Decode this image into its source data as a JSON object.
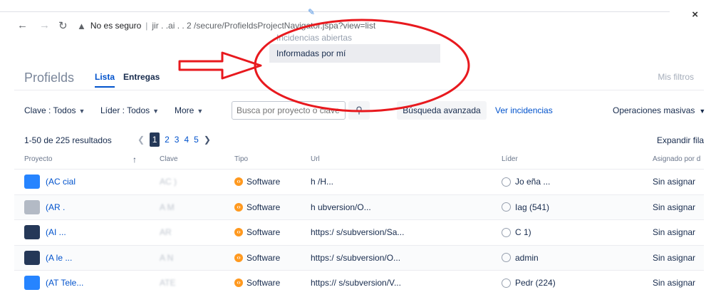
{
  "browser": {
    "security_label": "No es seguro",
    "url": "jir  .   .ai  .  .  2  /secure/ProfieldsProjectNavigator.jspa?view=list",
    "close_icon": "close-icon"
  },
  "dropdown": {
    "items": [
      {
        "label": "Incidencias abiertas"
      },
      {
        "label": "Informadas por mí"
      }
    ]
  },
  "header": {
    "title": "Profields",
    "tabs": [
      {
        "label": "Lista"
      },
      {
        "label": "Entregas"
      }
    ],
    "right_link": "Mis filtros"
  },
  "filters": {
    "clave": "Clave : Todos",
    "lider": "Líder : Todos",
    "more": "More",
    "search_placeholder": "Busca por proyecto o clave",
    "advanced": "Búsqueda avanzada",
    "ver": "Ver incidencias",
    "ops": "Operaciones masivas"
  },
  "pagination": {
    "results": "1-50 de 225 resultados",
    "pages": [
      "1",
      "2",
      "3",
      "4",
      "5"
    ],
    "current": "1",
    "expand": "Expandir fila"
  },
  "table": {
    "headers": [
      "Proyecto",
      "Clave",
      "Tipo",
      "Url",
      "Líder",
      "Asignado por d"
    ],
    "rows": [
      {
        "proyecto": "(AC          cial",
        "clave": "AC   )",
        "tipo": "Software",
        "url": "h                                     /H...",
        "lider": "Jo          eña ...",
        "asignado": "Sin asignar",
        "icon_color": "#2684ff"
      },
      {
        "proyecto": "(AR          .",
        "clave": "A   M",
        "tipo": "Software",
        "url": "h                   ubversion/O...",
        "lider": "Iag              (541)",
        "asignado": "Sin asignar",
        "icon_color": "#b3bac5"
      },
      {
        "proyecto": "(AI          ...",
        "clave": "AR   ",
        "tipo": "Software",
        "url": "https:/               s/subversion/Sa...",
        "lider": "C               1)",
        "asignado": "Sin asignar",
        "icon_color": "#253858"
      },
      {
        "proyecto": "(A          le ...",
        "clave": "A   N",
        "tipo": "Software",
        "url": "https:/               s/subversion/O...",
        "lider": "admin",
        "asignado": "Sin asignar",
        "icon_color": "#253858"
      },
      {
        "proyecto": "(AT        Tele...",
        "clave": "ATE",
        "tipo": "Software",
        "url": "https://             s/subversion/V...",
        "lider": "Pedr          (224)",
        "asignado": "Sin asignar",
        "icon_color": "#2684ff"
      }
    ]
  },
  "colors": {
    "accent": "#0052cc",
    "annotation": "#e8191e",
    "tipo": "#ff991f"
  }
}
